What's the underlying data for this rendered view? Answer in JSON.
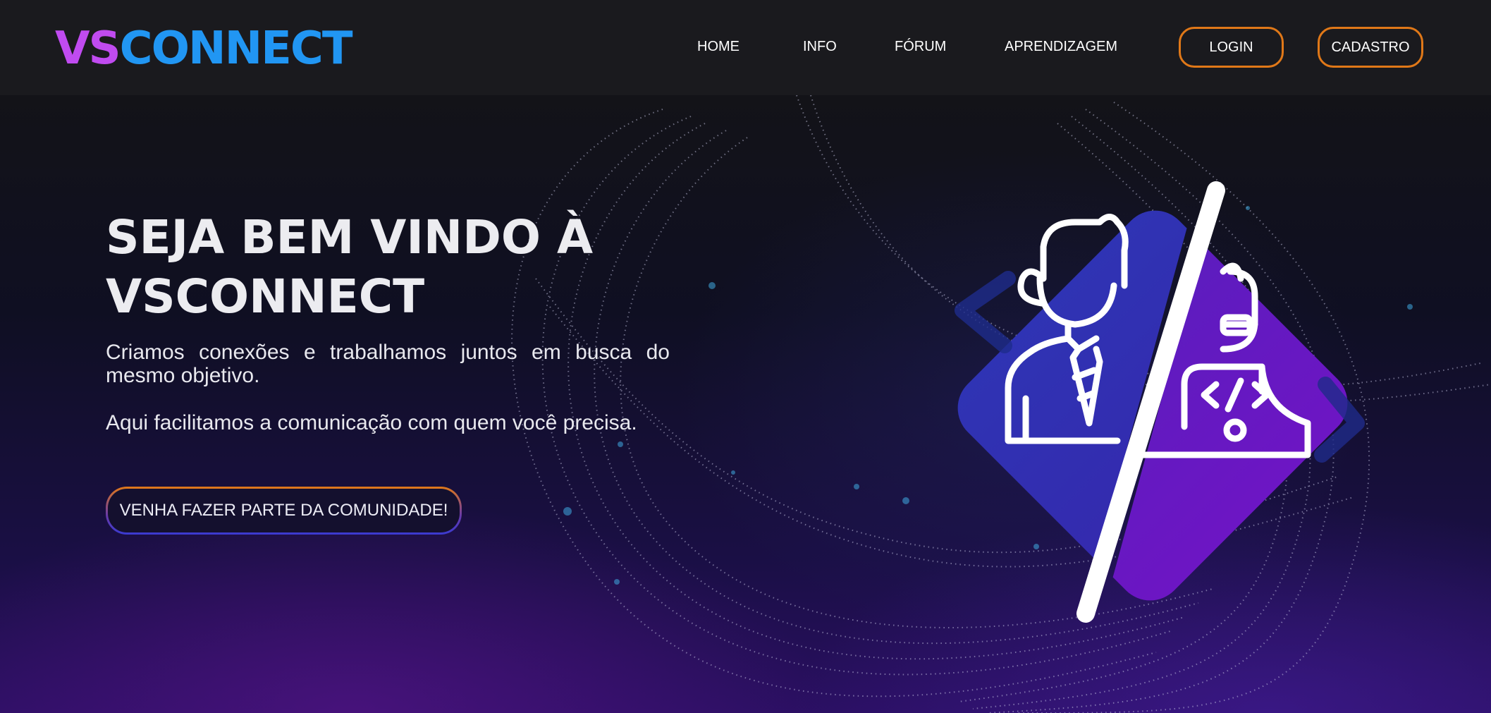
{
  "logo": {
    "part1": "VS",
    "part2": "CONNECT"
  },
  "nav": {
    "home": "HOME",
    "info": "INFO",
    "forum": "FÓRUM",
    "learning": "APRENDIZAGEM"
  },
  "auth": {
    "login": "LOGIN",
    "signup": "CADASTRO"
  },
  "hero": {
    "title_line1": "SEJA BEM VINDO À",
    "title_line2": "VSCONNECT",
    "subtitle": "Criamos conexões e trabalhamos juntos em busca do mesmo objetivo.",
    "subtitle2": "Aqui facilitamos a comunicação com quem você precisa.",
    "cta": "VENHA FAZER PARTE DA COMUNIDADE!"
  },
  "colors": {
    "logo_vs": "#c04bf0",
    "logo_connect": "#2196f3",
    "button_border": "#e07818",
    "illustration_blue": "#2a2aa8",
    "illustration_purple": "#7a10c8"
  },
  "icons": [
    "businessman-icon",
    "developer-icon",
    "code-brackets-icon",
    "chevron-left-icon",
    "chevron-right-icon"
  ]
}
